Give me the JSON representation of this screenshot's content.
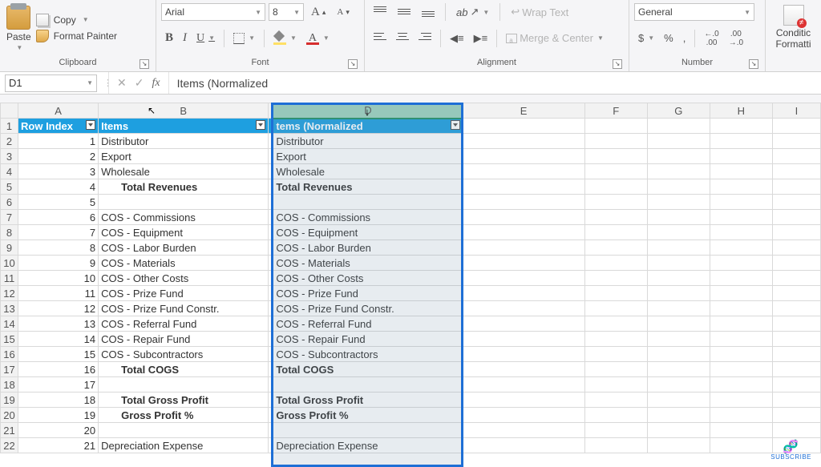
{
  "ribbon": {
    "clipboard": {
      "paste": "Paste",
      "copy": "Copy",
      "format_painter": "Format Painter",
      "group_label": "Clipboard"
    },
    "font": {
      "name": "Arial",
      "size": "8",
      "grow": "A",
      "shrink": "A",
      "bold": "B",
      "italic": "I",
      "underline": "U",
      "group_label": "Font"
    },
    "alignment": {
      "wrap_text": "Wrap Text",
      "merge_center": "Merge & Center",
      "group_label": "Alignment"
    },
    "number": {
      "format": "General",
      "currency": "$",
      "percent": "%",
      "comma": ",",
      "inc_dec": ".00",
      "group_label": "Number"
    },
    "conditional": {
      "line1": "Conditic",
      "line2": "Formatti"
    }
  },
  "formula_bar": {
    "name_box": "D1",
    "cancel": "✕",
    "enter": "✓",
    "fx": "fx",
    "value": "Items (Normalized"
  },
  "columns": [
    "A",
    "B",
    "",
    "D",
    "E",
    "F",
    "G",
    "H",
    "I"
  ],
  "header_row": {
    "A": "Row Index",
    "B": "Items",
    "D": "tems (Normalized"
  },
  "rows": [
    {
      "n": 2,
      "a": "1",
      "b": "Distributor",
      "d": "Distributor",
      "bold": false,
      "indent": false
    },
    {
      "n": 3,
      "a": "2",
      "b": "Export",
      "d": "Export",
      "bold": false,
      "indent": false
    },
    {
      "n": 4,
      "a": "3",
      "b": "Wholesale",
      "d": "Wholesale",
      "bold": false,
      "indent": false
    },
    {
      "n": 5,
      "a": "4",
      "b": "Total Revenues",
      "d": "Total Revenues",
      "bold": true,
      "indent": true
    },
    {
      "n": 6,
      "a": "5",
      "b": "",
      "d": "",
      "bold": false,
      "indent": false
    },
    {
      "n": 7,
      "a": "6",
      "b": "COS - Commissions",
      "d": "COS - Commissions",
      "bold": false,
      "indent": false
    },
    {
      "n": 8,
      "a": "7",
      "b": "COS - Equipment",
      "d": "COS - Equipment",
      "bold": false,
      "indent": false
    },
    {
      "n": 9,
      "a": "8",
      "b": "COS - Labor Burden",
      "d": "COS - Labor Burden",
      "bold": false,
      "indent": false
    },
    {
      "n": 10,
      "a": "9",
      "b": "COS - Materials",
      "d": "COS - Materials",
      "bold": false,
      "indent": false
    },
    {
      "n": 11,
      "a": "10",
      "b": "COS - Other Costs",
      "d": "COS - Other Costs",
      "bold": false,
      "indent": false
    },
    {
      "n": 12,
      "a": "11",
      "b": "COS - Prize Fund",
      "d": "COS - Prize Fund",
      "bold": false,
      "indent": false
    },
    {
      "n": 13,
      "a": "12",
      "b": "COS - Prize Fund Constr.",
      "d": "COS - Prize Fund Constr.",
      "bold": false,
      "indent": false
    },
    {
      "n": 14,
      "a": "13",
      "b": "COS - Referral Fund",
      "d": "COS - Referral Fund",
      "bold": false,
      "indent": false
    },
    {
      "n": 15,
      "a": "14",
      "b": "COS - Repair Fund",
      "d": "COS - Repair Fund",
      "bold": false,
      "indent": false
    },
    {
      "n": 16,
      "a": "15",
      "b": "COS - Subcontractors",
      "d": "COS - Subcontractors",
      "bold": false,
      "indent": false
    },
    {
      "n": 17,
      "a": "16",
      "b": "Total COGS",
      "d": "Total COGS",
      "bold": true,
      "indent": true
    },
    {
      "n": 18,
      "a": "17",
      "b": "",
      "d": "",
      "bold": false,
      "indent": false
    },
    {
      "n": 19,
      "a": "18",
      "b": "Total Gross Profit",
      "d": "Total Gross Profit",
      "bold": true,
      "indent": true
    },
    {
      "n": 20,
      "a": "19",
      "b": "Gross Profit %",
      "d": "Gross Profit %",
      "bold": true,
      "indent": true
    },
    {
      "n": 21,
      "a": "20",
      "b": "",
      "d": "",
      "bold": false,
      "indent": false
    },
    {
      "n": 22,
      "a": "21",
      "b": "Depreciation Expense",
      "d": "Depreciation Expense",
      "bold": false,
      "indent": false
    }
  ],
  "subscribe_label": "SUBSCRIBE"
}
